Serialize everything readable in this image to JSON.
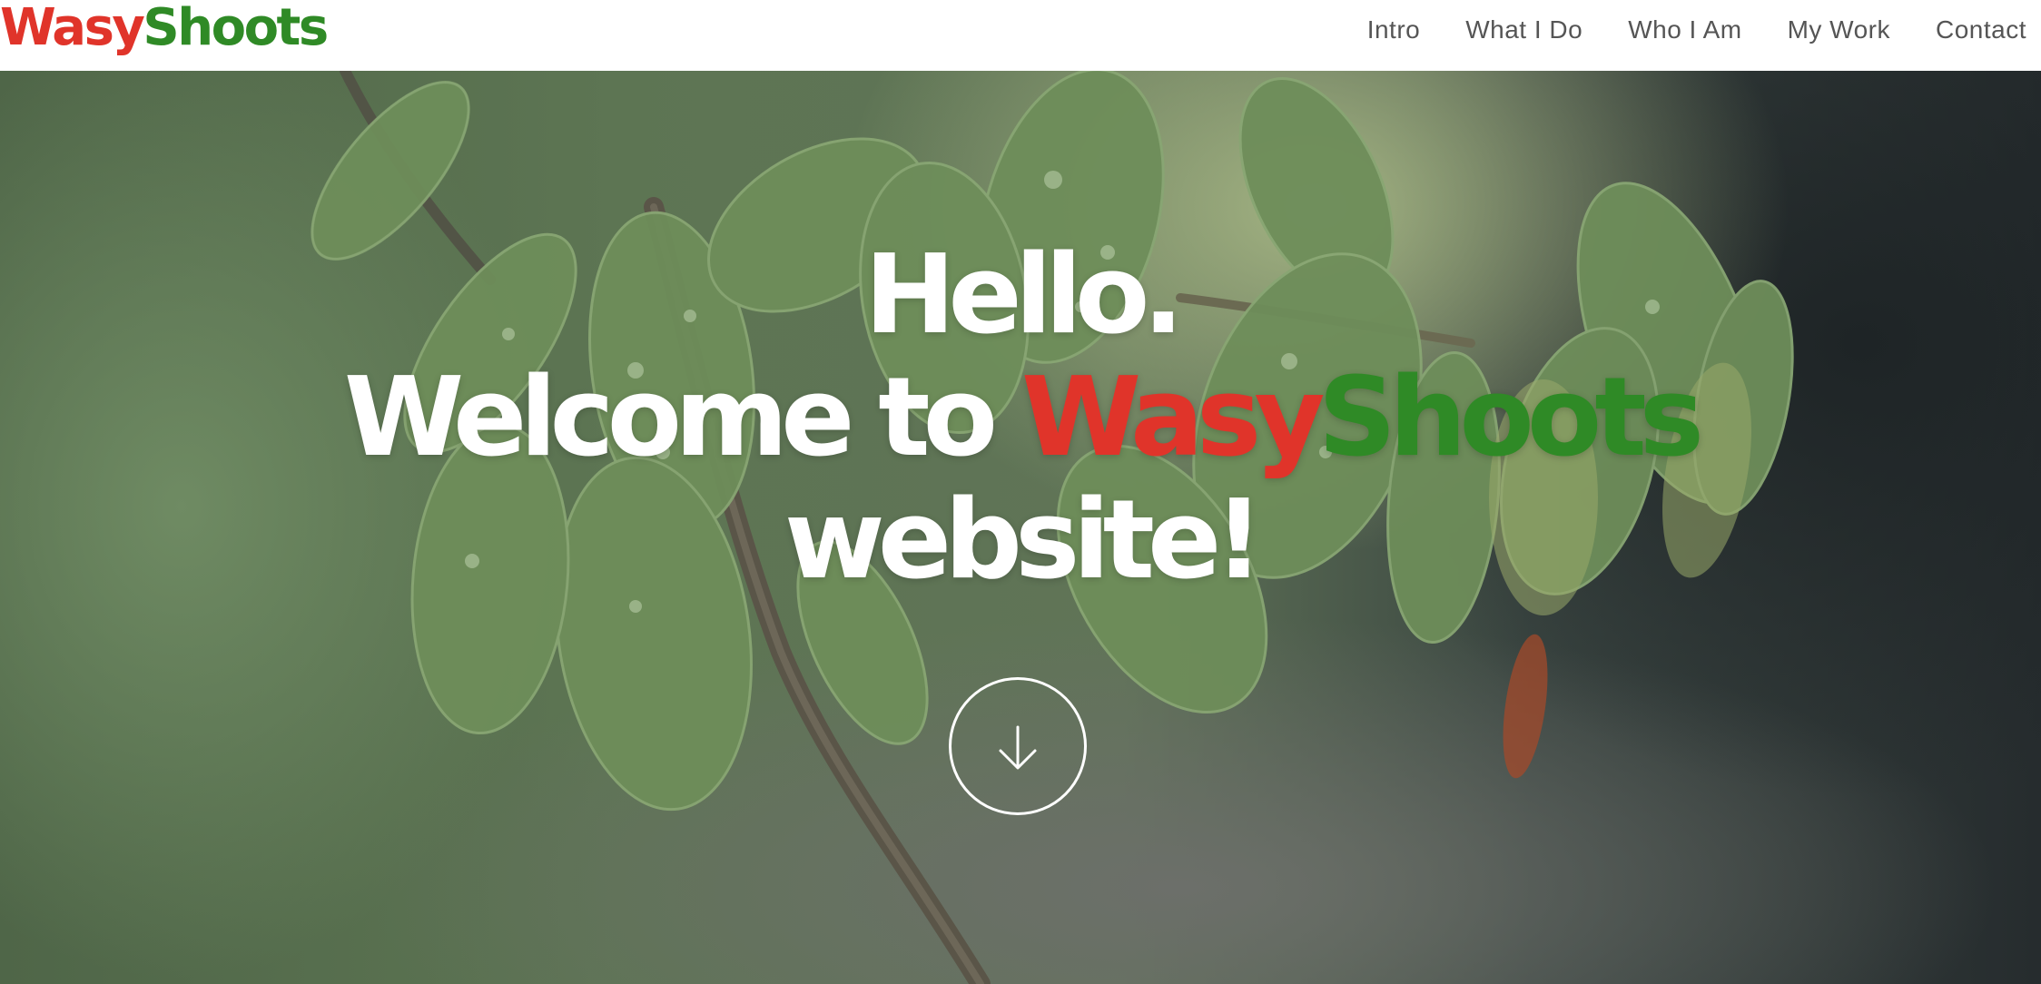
{
  "brand": {
    "part1": "Wasy",
    "part2": "Shoots",
    "color1": "#e0342a",
    "color2": "#2f8a26"
  },
  "nav": {
    "items": [
      {
        "label": "Intro"
      },
      {
        "label": "What I Do"
      },
      {
        "label": "Who I Am"
      },
      {
        "label": "My Work"
      },
      {
        "label": "Contact"
      }
    ]
  },
  "hero": {
    "line1": "Hello.",
    "line2_prefix": "Welcome to ",
    "line2_brand1": "Wasy",
    "line2_brand2": "Shoots",
    "line3": "website!",
    "scroll_icon": "arrow-down-icon"
  },
  "colors": {
    "text": "#ffffff",
    "nav_text": "#555555"
  }
}
